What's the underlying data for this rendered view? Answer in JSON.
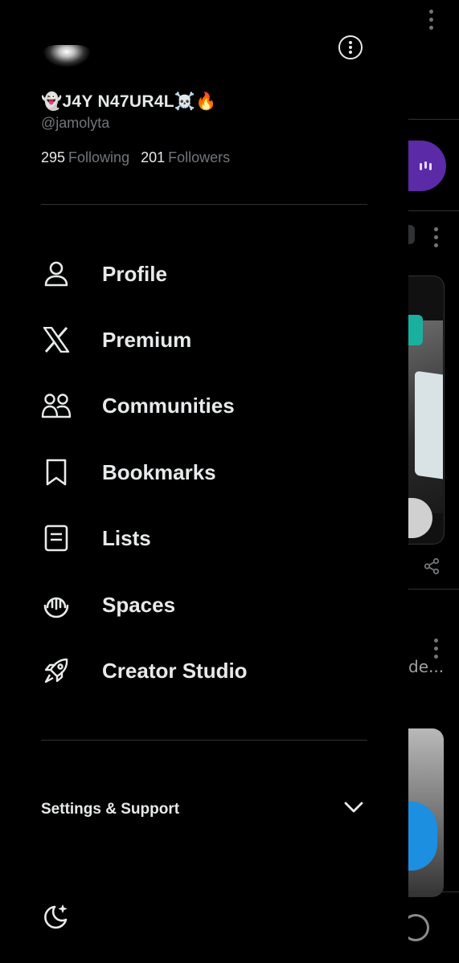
{
  "profile": {
    "display_name": "👻J4Y N47UR4L☠️🔥",
    "handle": "@jamolyta",
    "following_count": "295",
    "following_label": "Following",
    "followers_count": "201",
    "followers_label": "Followers"
  },
  "menu": {
    "items": [
      {
        "label": "Profile",
        "icon": "person-icon"
      },
      {
        "label": "Premium",
        "icon": "x-logo-icon"
      },
      {
        "label": "Communities",
        "icon": "communities-icon"
      },
      {
        "label": "Bookmarks",
        "icon": "bookmark-icon"
      },
      {
        "label": "Lists",
        "icon": "list-icon"
      },
      {
        "label": "Spaces",
        "icon": "spaces-icon"
      },
      {
        "label": "Creator Studio",
        "icon": "rocket-icon"
      }
    ]
  },
  "settings": {
    "label": "Settings & Support",
    "icon": "chevron-down-icon"
  },
  "background": {
    "truncated_text": "de..."
  },
  "colors": {
    "background": "#000000",
    "text": "#e7e9ea",
    "muted": "#71767b",
    "divider": "#2f3336",
    "spaces_purple": "#5b2aa7",
    "fab_blue": "#1d8fe0"
  }
}
